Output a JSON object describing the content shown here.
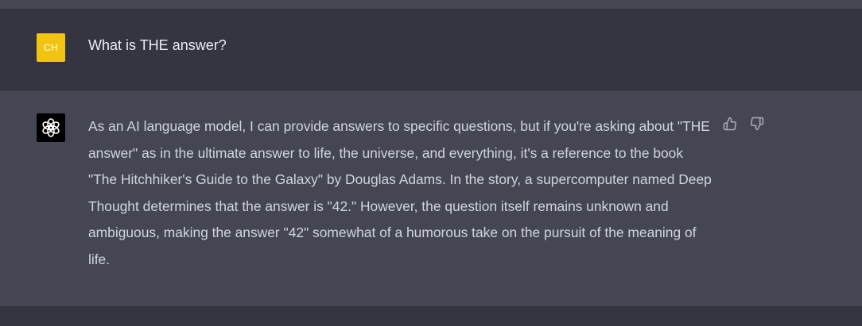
{
  "user_message": {
    "avatar_initials": "CH",
    "avatar_color": "#f1c40f",
    "text": "What is THE answer?"
  },
  "assistant_message": {
    "avatar_icon": "openai-logo-icon",
    "text": "As an AI language model, I can provide answers to specific questions, but if you're asking about \"THE answer\" as in the ultimate answer to life, the universe, and everything, it's a reference to the book \"The Hitchhiker's Guide to the Galaxy\" by Douglas Adams. In the story, a supercomputer named Deep Thought determines that the answer is \"42.\" However, the question itself remains unknown and ambiguous, making the answer \"42\" somewhat of a humorous take on the pursuit of the meaning of life."
  },
  "feedback": {
    "thumbs_up_icon": "thumbs-up-icon",
    "thumbs_down_icon": "thumbs-down-icon"
  },
  "colors": {
    "user_row_bg": "#343541",
    "assistant_row_bg": "#444654",
    "user_text": "#ececf1",
    "assistant_text": "#d1d5db"
  }
}
